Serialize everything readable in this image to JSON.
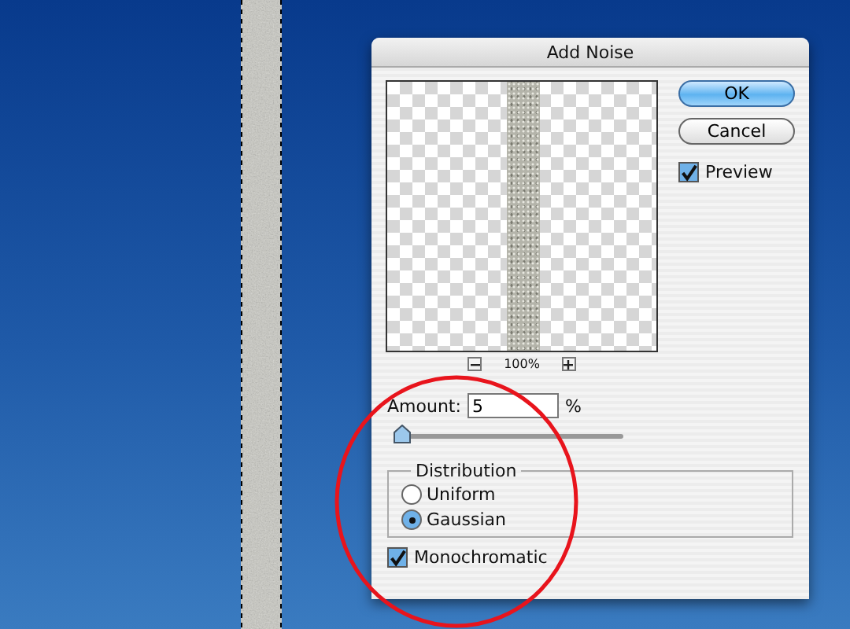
{
  "dialog": {
    "title": "Add Noise",
    "zoom_level": "100%",
    "buttons": [
      {
        "label": "OK",
        "default": true
      },
      {
        "label": "Cancel",
        "default": false
      }
    ],
    "preview": {
      "label": "Preview",
      "checked": true
    },
    "amount": {
      "label": "Amount:",
      "value": "5",
      "unit": "%",
      "level": 0.01
    },
    "distribution": {
      "legend": "Distribution",
      "options": [
        {
          "label": "Uniform",
          "selected": false
        },
        {
          "label": "Gaussian",
          "selected": true
        }
      ]
    },
    "monochromatic": {
      "label": "Monochromatic",
      "checked": true
    }
  }
}
